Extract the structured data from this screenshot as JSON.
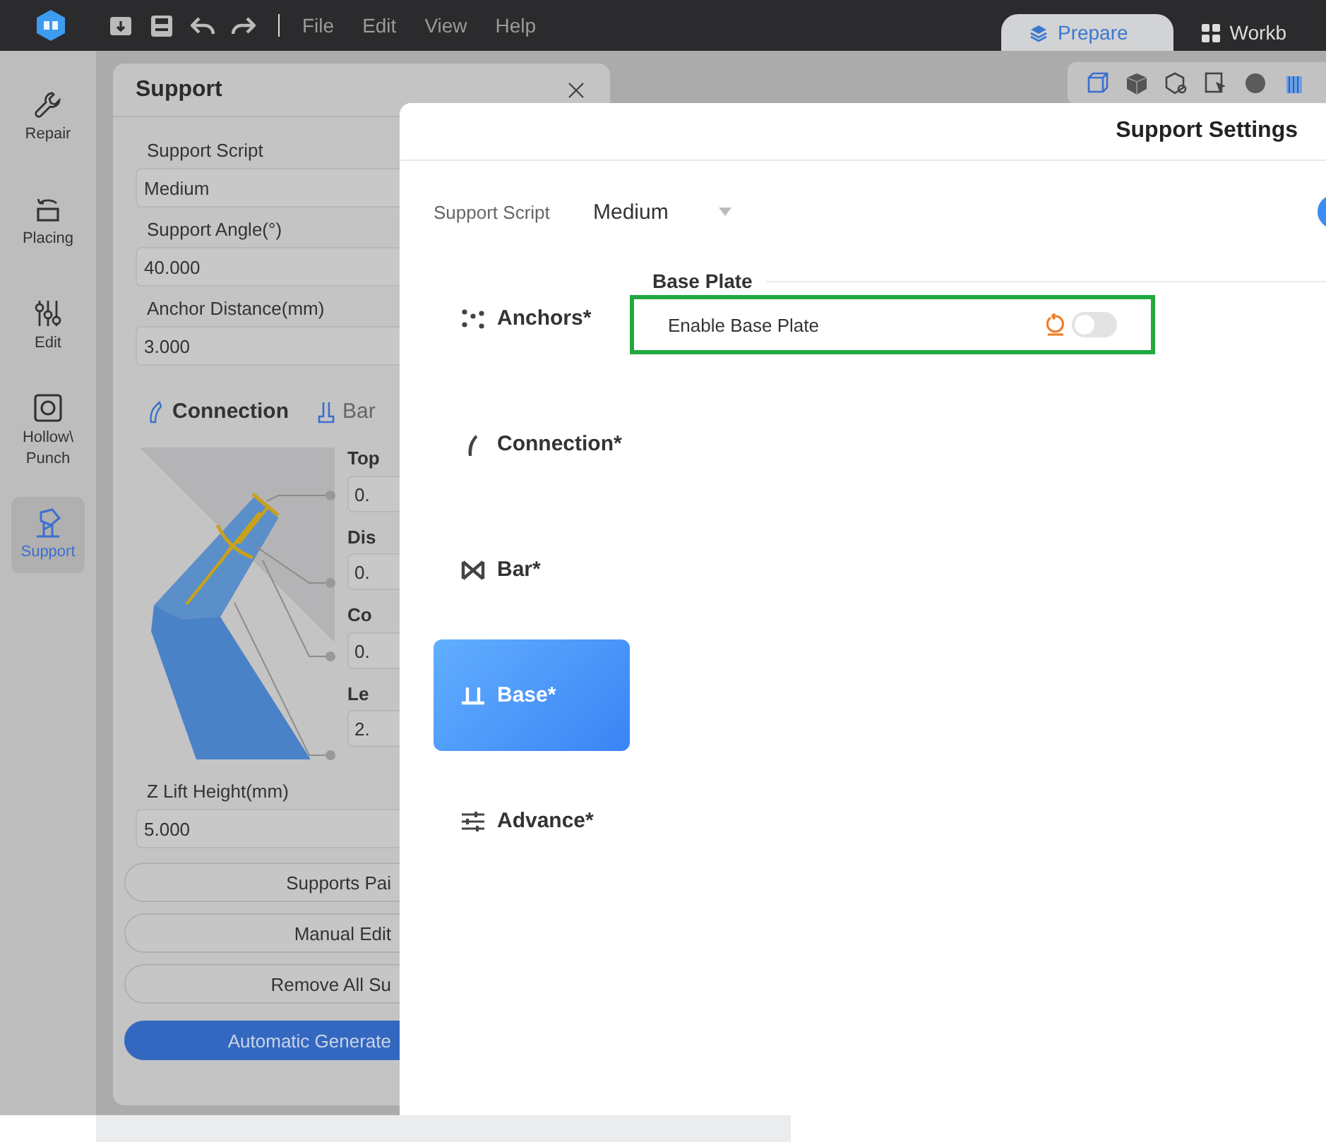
{
  "menu_bar": {
    "menus": [
      "File",
      "Edit",
      "View",
      "Help"
    ],
    "tabs": [
      {
        "label": "Prepare",
        "selected": true
      },
      {
        "label": "Workb",
        "selected": false
      }
    ]
  },
  "sidebar": {
    "items": [
      {
        "label": "Repair",
        "kind": "repair",
        "selected": false
      },
      {
        "label": "Placing",
        "kind": "placing",
        "selected": false
      },
      {
        "label": "Edit",
        "kind": "edit",
        "selected": false
      },
      {
        "label": "Hollow\\\nPunch",
        "kind": "hollow",
        "selected": false
      },
      {
        "label": "Support",
        "kind": "support",
        "selected": true
      }
    ]
  },
  "support_panel": {
    "title": "Support",
    "fields": [
      {
        "label": "Support Script",
        "value": "Medium"
      },
      {
        "label": "Support Angle(°)",
        "value": "40.000"
      },
      {
        "label": "Anchor Distance(mm)",
        "value": "3.000"
      }
    ],
    "subtabs": [
      {
        "label": "Connection",
        "kind": "connection",
        "selected": true
      },
      {
        "label": "Bar",
        "kind": "bar",
        "selected": false
      }
    ],
    "parameters": [
      {
        "label": "Top",
        "value": "0."
      },
      {
        "label": "Dis",
        "value": "0."
      },
      {
        "label": "Co",
        "value": "0."
      },
      {
        "label": "Le",
        "value": "2."
      }
    ],
    "z_lift": {
      "label": "Z Lift Height(mm)",
      "value": "5.000"
    },
    "buttons": [
      "Supports Pai",
      "Manual Edit",
      "Remove All Su"
    ],
    "primary_button": "Automatic Generate"
  },
  "dialog": {
    "title": "Support Settings",
    "script": {
      "label": "Support Script",
      "value": "Medium"
    },
    "nav": [
      {
        "label": "Anchors*",
        "kind": "anchors",
        "selected": false
      },
      {
        "label": "Connection*",
        "kind": "connection",
        "selected": false
      },
      {
        "label": "Bar*",
        "kind": "bar",
        "selected": false
      },
      {
        "label": "Base*",
        "kind": "base",
        "selected": true
      },
      {
        "label": "Advance*",
        "kind": "advance",
        "selected": false
      }
    ],
    "section": {
      "title": "Base Plate",
      "settings": [
        {
          "label": "Enable Base Plate",
          "on": false,
          "highlighted": true
        }
      ]
    }
  }
}
